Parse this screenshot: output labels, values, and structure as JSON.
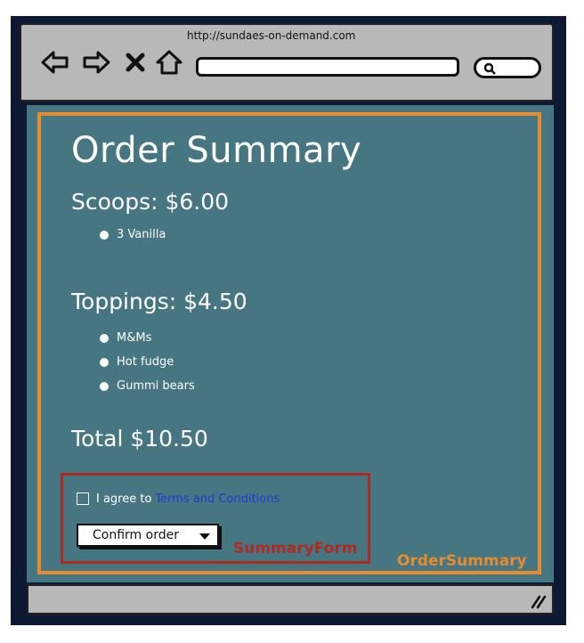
{
  "browser": {
    "url": "http://sundaes-on-demand.com",
    "address_value": "",
    "search_value": ""
  },
  "icons": {
    "back": "arrow-left-icon",
    "forward": "arrow-right-icon",
    "stop": "close-icon",
    "home": "home-icon",
    "search": "search-icon",
    "resize": "resize-grip-icon"
  },
  "order_summary": {
    "title": "Order Summary",
    "scoops_heading": "Scoops: $6.00",
    "scoops": [
      "3 Vanilla"
    ],
    "toppings_heading": "Toppings: $4.50",
    "toppings": [
      "M&Ms",
      "Hot fudge",
      "Gummi bears"
    ],
    "total": "Total $10.50",
    "component_label": "OrderSummary"
  },
  "summary_form": {
    "checkbox_checked": false,
    "agree_text": "I agree to",
    "terms_link": "Terms and Conditions",
    "confirm_label": "Confirm order",
    "component_label": "SummaryForm"
  },
  "colors": {
    "content_bg": "#467681",
    "order_outline": "#e88b2e",
    "form_outline": "#b02a1f",
    "link": "#1f3ad6"
  }
}
